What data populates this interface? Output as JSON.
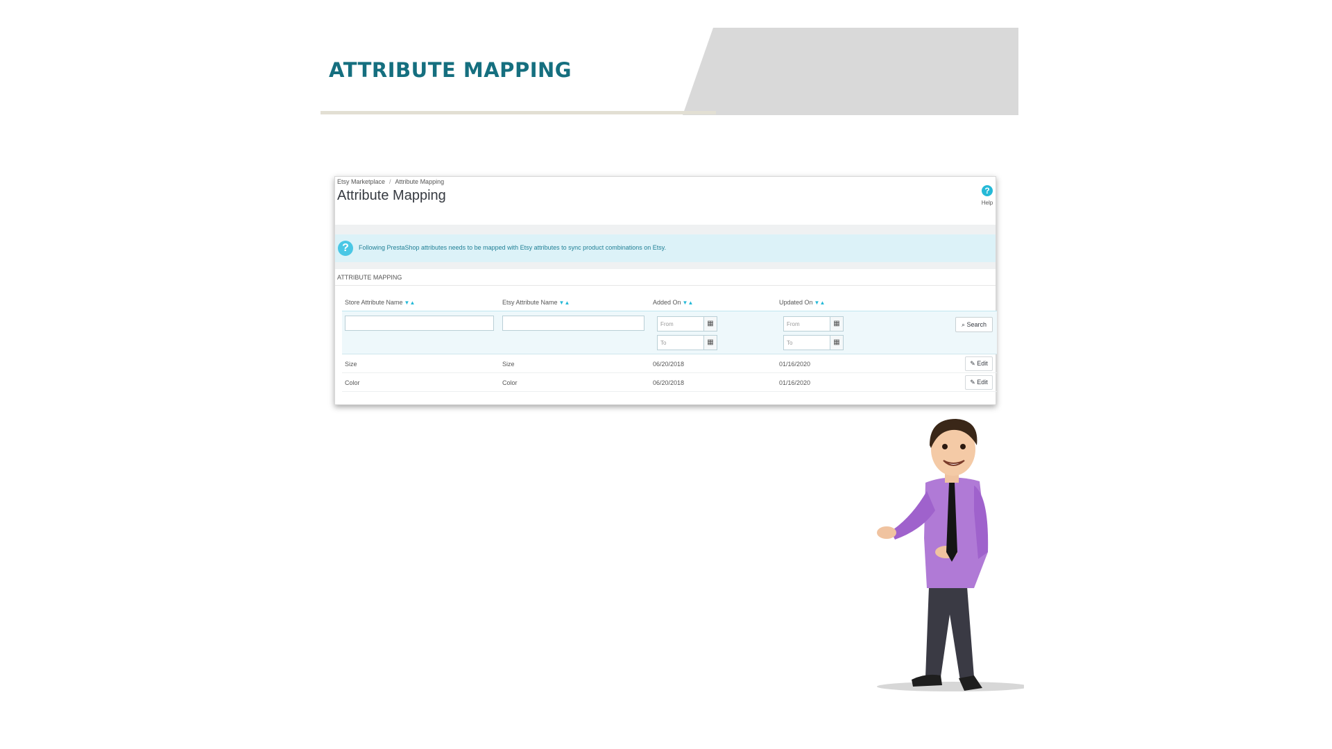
{
  "banner": {
    "title": "ATTRIBUTE MAPPING",
    "accent_color": "#156f7f"
  },
  "breadcrumb": {
    "items": [
      "Etsy Marketplace",
      "Attribute Mapping"
    ],
    "separator": "/"
  },
  "page": {
    "title": "Attribute Mapping",
    "help_label": "Help"
  },
  "alert": {
    "text": "Following PrestaShop attributes needs to be mapped with Etsy attributes to sync product combinations on Etsy."
  },
  "section": {
    "title": "ATTRIBUTE MAPPING"
  },
  "table": {
    "columns": [
      "Store Attribute Name",
      "Etsy Attribute Name",
      "Added On",
      "Updated On"
    ],
    "filters": {
      "added_from_placeholder": "From",
      "added_to_placeholder": "To",
      "updated_from_placeholder": "From",
      "updated_to_placeholder": "To",
      "search_label": "Search"
    },
    "rows": [
      {
        "store": "Size",
        "etsy": "Size",
        "added": "06/20/2018",
        "updated": "01/16/2020",
        "action": "Edit"
      },
      {
        "store": "Color",
        "etsy": "Color",
        "added": "06/20/2018",
        "updated": "01/16/2020",
        "action": "Edit"
      }
    ]
  },
  "icons": {
    "help": "question-circle-icon",
    "alert": "question-circle-icon",
    "calendar": "calendar-icon",
    "search": "search-icon",
    "edit": "pencil-icon",
    "sort": "sort-arrows-icon"
  }
}
